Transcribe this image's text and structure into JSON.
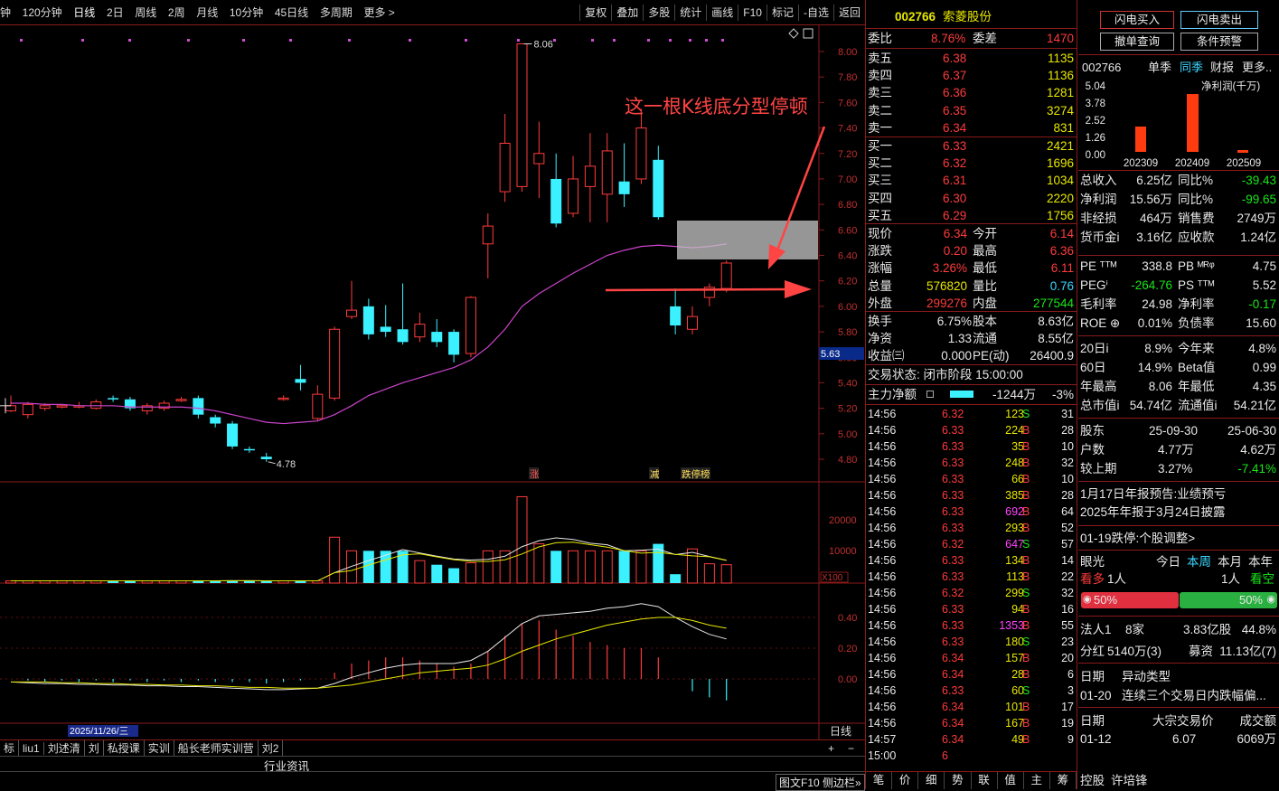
{
  "toolbar": {
    "left": [
      "钟",
      "120分钟",
      "日线",
      "2日",
      "周线",
      "2周",
      "月线",
      "10分钟",
      "45日线",
      "多周期",
      "更多 >"
    ],
    "right": [
      "复权",
      "叠加",
      "多股",
      "统计",
      "画线",
      "F10",
      "标记",
      "-自选",
      "返回"
    ]
  },
  "stock": {
    "code": "002766",
    "name": "索菱股份"
  },
  "quote": {
    "weibi_label": "委比",
    "weibi": "8.76%",
    "weicha_label": "委差",
    "weicha": "1470",
    "asks": [
      {
        "label": "卖五",
        "price": "6.38",
        "vol": "1135"
      },
      {
        "label": "卖四",
        "price": "6.37",
        "vol": "1136"
      },
      {
        "label": "卖三",
        "price": "6.36",
        "vol": "1281"
      },
      {
        "label": "卖二",
        "price": "6.35",
        "vol": "3274"
      },
      {
        "label": "卖一",
        "price": "6.34",
        "vol": "831"
      }
    ],
    "bids": [
      {
        "label": "买一",
        "price": "6.33",
        "vol": "2421"
      },
      {
        "label": "买二",
        "price": "6.32",
        "vol": "1696"
      },
      {
        "label": "买三",
        "price": "6.31",
        "vol": "1034"
      },
      {
        "label": "买四",
        "price": "6.30",
        "vol": "2220"
      },
      {
        "label": "买五",
        "price": "6.29",
        "vol": "1756"
      }
    ],
    "stats": [
      {
        "l1": "现价",
        "v1": "6.34",
        "l2": "今开",
        "v2": "6.14"
      },
      {
        "l1": "涨跌",
        "v1": "0.20",
        "l2": "最高",
        "v2": "6.36"
      },
      {
        "l1": "涨幅",
        "v1": "3.26%",
        "l2": "最低",
        "v2": "6.11"
      },
      {
        "l1": "总量",
        "v1": "576820",
        "l2": "量比",
        "v2": "0.76"
      },
      {
        "l1": "外盘",
        "v1": "299276",
        "l2": "内盘",
        "v2": "277544"
      }
    ],
    "stats2": [
      {
        "l1": "换手",
        "v1": "6.75%",
        "l2": "股本",
        "v2": "8.63亿"
      },
      {
        "l1": "净资",
        "v1": "1.33",
        "l2": "流通",
        "v2": "8.55亿"
      },
      {
        "l1": "收益㈢",
        "v1": "0.000",
        "l2": "PE(动)",
        "v2": "26400.9"
      }
    ],
    "status": "交易状态: 闭市阶段 15:00:00",
    "mainflow_label": "主力净额",
    "mainflow": "-1244万",
    "mainflow_pct": "-3%"
  },
  "ticks": [
    [
      "14:56",
      "6.32",
      "123",
      "S",
      "31"
    ],
    [
      "14:56",
      "6.33",
      "224",
      "B",
      "28"
    ],
    [
      "14:56",
      "6.33",
      "35",
      "B",
      "10"
    ],
    [
      "14:56",
      "6.33",
      "248",
      "B",
      "32"
    ],
    [
      "14:56",
      "6.33",
      "66",
      "B",
      "10"
    ],
    [
      "14:56",
      "6.33",
      "385",
      "B",
      "28"
    ],
    [
      "14:56",
      "6.33",
      "692",
      "B",
      "64"
    ],
    [
      "14:56",
      "6.33",
      "293",
      "B",
      "52"
    ],
    [
      "14:56",
      "6.32",
      "647",
      "S",
      "57"
    ],
    [
      "14:56",
      "6.33",
      "134",
      "B",
      "14"
    ],
    [
      "14:56",
      "6.33",
      "113",
      "B",
      "22"
    ],
    [
      "14:56",
      "6.32",
      "299",
      "S",
      "32"
    ],
    [
      "14:56",
      "6.33",
      "94",
      "B",
      "16"
    ],
    [
      "14:56",
      "6.33",
      "1353",
      "B",
      "55"
    ],
    [
      "14:56",
      "6.33",
      "180",
      "S",
      "23"
    ],
    [
      "14:56",
      "6.34",
      "157",
      "B",
      "20"
    ],
    [
      "14:56",
      "6.34",
      "28",
      "B",
      "6"
    ],
    [
      "14:56",
      "6.33",
      "60",
      "S",
      "3"
    ],
    [
      "14:56",
      "6.34",
      "101",
      "B",
      "17"
    ],
    [
      "14:56",
      "6.34",
      "167",
      "B",
      "19"
    ],
    [
      "14:57",
      "6.34",
      "49",
      "B",
      "9"
    ],
    [
      "15:00",
      "6",
      "",
      "",
      " "
    ]
  ],
  "bottom_mid": [
    "笔",
    "价",
    "细",
    "势",
    "联",
    "值",
    "主",
    "筹"
  ],
  "right": {
    "buttons": [
      "闪电买入",
      "闪电卖出",
      "撤单查询",
      "条件预警"
    ],
    "tabs": [
      "002766",
      "单季",
      "同季",
      "财报",
      "更多.."
    ],
    "fin_chart_title": "净利润(千万)",
    "fin_rows": [
      {
        "l1": "总收入",
        "v1": "6.25亿",
        "l2": "同比%",
        "v2": "-39.43"
      },
      {
        "l1": "净利润",
        "v1": "15.56万",
        "l2": "同比%",
        "v2": "-99.65"
      },
      {
        "l1": "非经损",
        "v1": "464万",
        "l2": "销售费",
        "v2": "2749万"
      },
      {
        "l1": "货币金i",
        "v1": "3.16亿",
        "l2": "应收款",
        "v2": "1.24亿"
      }
    ],
    "val_rows": [
      {
        "l1": "PE ᵀᵀᴹ",
        "v1": "338.8",
        "l2": "PB ᴹᴿᵠ",
        "v2": "4.75"
      },
      {
        "l1": "PEGⁱ",
        "v1": "-264.76",
        "l2": "PS ᵀᵀᴹ",
        "v2": "5.52"
      },
      {
        "l1": "毛利率",
        "v1": "24.98",
        "l2": "净利率",
        "v2": "-0.17"
      },
      {
        "l1": "ROE ⊕",
        "v1": "0.01%",
        "l2": "负债率",
        "v2": "15.60"
      }
    ],
    "perf_rows": [
      {
        "l1": "20日i",
        "v1": "8.9%",
        "l2": "今年来",
        "v2": "4.8%"
      },
      {
        "l1": "60日",
        "v1": "14.9%",
        "l2": "Beta值",
        "v2": "0.99"
      },
      {
        "l1": "年最高",
        "v1": "8.06",
        "l2": "年最低",
        "v2": "4.35"
      },
      {
        "l1": "总市值i",
        "v1": "54.74亿",
        "l2": "流通值i",
        "v2": "54.21亿"
      }
    ],
    "holder_head": {
      "l1": "股东",
      "v1": "25-09-30",
      "v2": "25-06-30"
    },
    "holder_rows": [
      {
        "l1": "户数",
        "v1": "4.77万",
        "v2": "4.62万"
      },
      {
        "l1": "较上期",
        "v1": "3.27%",
        "v2": "-7.41%"
      }
    ],
    "notice1": "1月17日年报预告:业绩预亏",
    "notice2": "2025年年报于3月24日披露",
    "notice3": "01-19跌停:个股调整>",
    "eye": {
      "label": "眼光",
      "tabs": [
        "今日",
        "本周",
        "本月",
        "本年"
      ],
      "bull": "看多",
      "bull_n": "1人",
      "bear_n": "1人",
      "bear": "看空",
      "pct1": "50%",
      "pct2": "50%"
    },
    "faren": {
      "l": "法人1",
      "n": "8家",
      "amt": "3.83亿股",
      "pct": "44.8%"
    },
    "fenhong": {
      "l": "分红",
      "v": "5140万(3)",
      "l2": "募资",
      "v2": "11.13亿(7)"
    },
    "date_label": "日期",
    "yidong_label": "异动类型",
    "yidong": {
      "d": "01-20",
      "t": "连续三个交易日内跌幅偏..."
    },
    "block_head": {
      "d": "日期",
      "p": "大宗交易价",
      "v": "成交额"
    },
    "block_row": {
      "d": "01-12",
      "p": "6.07",
      "v": "6069万"
    },
    "bottom": [
      "控股",
      "许培锋"
    ]
  },
  "chart": {
    "annotation": "这一根K线底分型停顿",
    "price_ticks": [
      "8.00",
      "7.80",
      "7.60",
      "7.40",
      "7.20",
      "7.00",
      "6.80",
      "6.60",
      "6.40",
      "6.20",
      "6.00",
      "5.80",
      "5.60",
      "5.40",
      "5.20",
      "5.00",
      "4.80"
    ],
    "current_price_tag": "5.63",
    "high_label": "8.06",
    "low_label": "4.78",
    "vol_ticks": [
      "20000",
      "10000"
    ],
    "vol_unit": "X100",
    "macd_ticks": [
      "0.40",
      "0.20",
      "0.00"
    ],
    "markers": [
      "涨",
      "减",
      "跌停榜"
    ],
    "date_tag": "2025/11/26/三",
    "period_label": "日线",
    "candles": [
      [
        5.18,
        5.22,
        5.3,
        5.17
      ],
      [
        5.15,
        5.23,
        5.25,
        5.12
      ],
      [
        5.2,
        5.22,
        5.24,
        5.18
      ],
      [
        5.21,
        5.22,
        5.23,
        5.2
      ],
      [
        5.22,
        5.22,
        5.25,
        5.2
      ],
      [
        5.2,
        5.25,
        5.27,
        5.19
      ],
      [
        5.28,
        5.27,
        5.3,
        5.25
      ],
      [
        5.27,
        5.2,
        5.29,
        5.18
      ],
      [
        5.18,
        5.22,
        5.24,
        5.15
      ],
      [
        5.2,
        5.24,
        5.26,
        5.18
      ],
      [
        5.26,
        5.27,
        5.29,
        5.25
      ],
      [
        5.28,
        5.15,
        5.3,
        5.12
      ],
      [
        5.13,
        5.08,
        5.15,
        5.05
      ],
      [
        5.08,
        4.9,
        5.1,
        4.88
      ],
      [
        4.88,
        4.87,
        4.9,
        4.85
      ],
      [
        4.82,
        4.8,
        4.85,
        4.78
      ],
      [
        5.27,
        5.28,
        5.3,
        5.26
      ],
      [
        5.43,
        5.4,
        5.54,
        5.34
      ],
      [
        5.12,
        5.31,
        5.38,
        5.1
      ],
      [
        5.28,
        5.82,
        5.84,
        5.26
      ],
      [
        5.92,
        5.97,
        6.2,
        5.9
      ],
      [
        6.0,
        5.78,
        6.06,
        5.74
      ],
      [
        5.84,
        5.8,
        6.01,
        5.76
      ],
      [
        5.82,
        5.72,
        6.18,
        5.7
      ],
      [
        5.76,
        5.86,
        5.95,
        5.72
      ],
      [
        5.8,
        5.72,
        5.9,
        5.68
      ],
      [
        5.8,
        5.62,
        5.82,
        5.56
      ],
      [
        5.63,
        6.07,
        6.08,
        5.6
      ],
      [
        6.49,
        6.63,
        6.73,
        6.22
      ],
      [
        6.9,
        7.28,
        7.51,
        6.82
      ],
      [
        6.94,
        8.06,
        8.06,
        6.9
      ],
      [
        7.12,
        7.2,
        7.45,
        6.85
      ],
      [
        7.0,
        6.65,
        7.2,
        6.62
      ],
      [
        6.73,
        7.0,
        7.18,
        6.7
      ],
      [
        6.94,
        7.1,
        7.36,
        6.66
      ],
      [
        6.88,
        7.22,
        7.36,
        6.66
      ],
      [
        6.98,
        6.88,
        7.28,
        6.78
      ],
      [
        7.0,
        7.4,
        7.55,
        6.96
      ],
      [
        7.15,
        6.7,
        7.26,
        6.68
      ],
      [
        6.0,
        5.85,
        6.14,
        5.78
      ],
      [
        5.82,
        5.92,
        6.0,
        5.78
      ],
      [
        6.07,
        6.15,
        6.18,
        6.0
      ],
      [
        6.14,
        6.34,
        6.36,
        6.11
      ]
    ],
    "gaps": [
      39
    ]
  }
}
